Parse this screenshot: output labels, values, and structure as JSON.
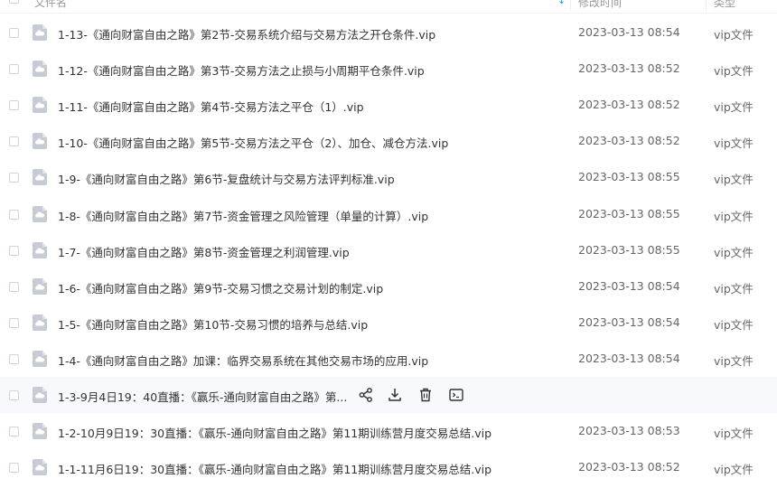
{
  "header": {
    "name_col": "文件名",
    "time_col": "修改时间",
    "type_col": "类型",
    "sort_indicator": "↓"
  },
  "rows": [
    {
      "name": "1-13-《通向财富自由之路》第2节-交易系统介绍与交易方法之开仓条件.vip",
      "time": "2023-03-13 08:54",
      "type": "vip文件"
    },
    {
      "name": "1-12-《通向财富自由之路》第3节-交易方法之止损与小周期平仓条件.vip",
      "time": "2023-03-13 08:52",
      "type": "vip文件"
    },
    {
      "name": "1-11-《通向财富自由之路》第4节-交易方法之平仓（1）.vip",
      "time": "2023-03-13 08:52",
      "type": "vip文件"
    },
    {
      "name": "1-10-《通向财富自由之路》第5节-交易方法之平仓（2）、加仓、减仓方法.vip",
      "time": "2023-03-13 08:52",
      "type": "vip文件"
    },
    {
      "name": "1-9-《通向财富自由之路》第6节-复盘统计与交易方法评判标准.vip",
      "time": "2023-03-13 08:55",
      "type": "vip文件"
    },
    {
      "name": "1-8-《通向财富自由之路》第7节-资金管理之风险管理（单量的计算）.vip",
      "time": "2023-03-13 08:55",
      "type": "vip文件"
    },
    {
      "name": "1-7-《通向财富自由之路》第8节-资金管理之利润管理.vip",
      "time": "2023-03-13 08:55",
      "type": "vip文件"
    },
    {
      "name": "1-6-《通向财富自由之路》第9节-交易习惯之交易计划的制定.vip",
      "time": "2023-03-13 08:54",
      "type": "vip文件"
    },
    {
      "name": "1-5-《通向财富自由之路》第10节-交易习惯的培养与总结.vip",
      "time": "2023-03-13 08:54",
      "type": "vip文件"
    },
    {
      "name": "1-4-《通向财富自由之路》加课：临界交易系统在其他交易市场的应用.vip",
      "time": "2023-03-13 08:54",
      "type": "vip文件"
    },
    {
      "name": "1-3-9月4日19：40直播：《赢乐-通向财富自由之路》第...",
      "time": "",
      "type": ""
    },
    {
      "name": "1-2-10月9日19：30直播：《赢乐-通向财富自由之路》第11期训练营月度交易总结.vip",
      "time": "2023-03-13 08:53",
      "type": "vip文件"
    },
    {
      "name": "1-1-11月6日19：30直播：《赢乐-通向财富自由之路》第11期训练营月度交易总结.vip",
      "time": "2023-03-13 08:52",
      "type": "vip文件"
    }
  ],
  "hover_row_index": 10,
  "row_actions": [
    "share-icon",
    "download-icon",
    "delete-icon",
    "more-icon"
  ],
  "colors": {
    "accent": "#06a7ff",
    "file_icon": "#c7ccd4",
    "hover_bg": "#f7f9fc"
  }
}
